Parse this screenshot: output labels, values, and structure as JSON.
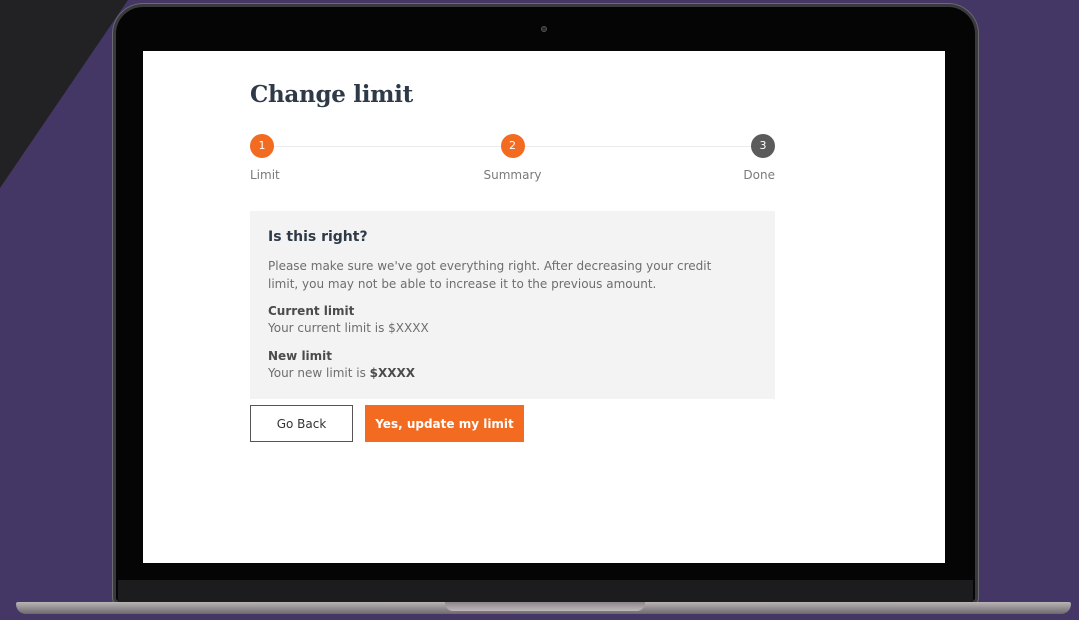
{
  "colors": {
    "accent": "#f26b21",
    "step_inactive": "#5b5b5b",
    "background": "#443766"
  },
  "page": {
    "title": "Change limit"
  },
  "stepper": {
    "steps": [
      {
        "number": "1",
        "label": "Limit",
        "state": "completed"
      },
      {
        "number": "2",
        "label": "Summary",
        "state": "current"
      },
      {
        "number": "3",
        "label": "Done",
        "state": "upcoming"
      }
    ]
  },
  "summary": {
    "heading": "Is this right?",
    "description": "Please make sure we've got everything right. After decreasing your credit limit, you may not be able to increase it to the previous amount.",
    "current_limit": {
      "label": "Current limit",
      "value": "Your current limit is $XXXX"
    },
    "new_limit": {
      "label": "New limit",
      "value_prefix": "Your new limit is ",
      "value_amount": "$XXXX"
    }
  },
  "actions": {
    "back_label": "Go Back",
    "confirm_label": "Yes, update my limit"
  }
}
